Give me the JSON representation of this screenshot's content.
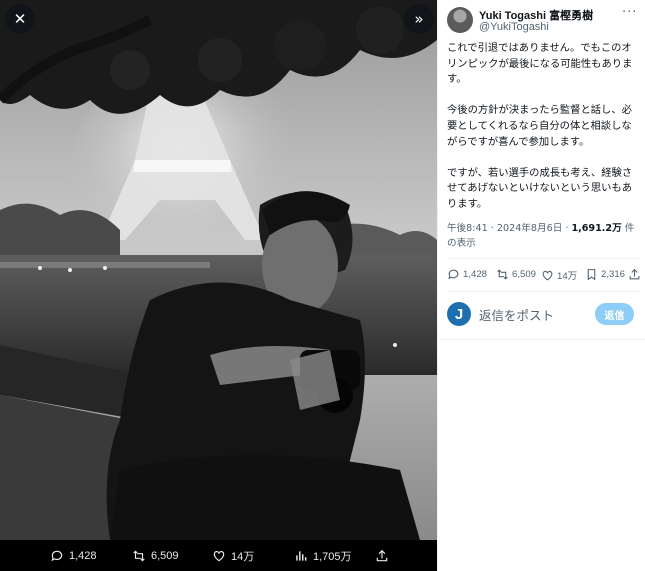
{
  "media": {
    "close_glyph": "✕",
    "expand_glyph": "»",
    "bar": {
      "replies": "1,428",
      "reposts": "6,509",
      "likes": "14万",
      "views": "1,705万"
    }
  },
  "post": {
    "author_name": "Yuki Togashi 富樫勇樹",
    "handle": "@YukiTogashi",
    "more_glyph": "···",
    "paragraphs": [
      "これで引退ではありません。でもこのオリンピックが最後になる可能性もあります。",
      "今後の方針が決まったら監督と話し、必要としてくれるなら自分の体と相談しながらですが喜んで参加します。",
      "ですが、若い選手の成長も考え、経験させてあげないといけないという思いもあります。"
    ],
    "timestamp": "午後8:41 · 2024年8月6日 · ",
    "view_count": "1,691.2万",
    "view_suffix": " 件の表示",
    "actions": {
      "replies": "1,428",
      "reposts": "6,509",
      "likes": "14万",
      "bookmarks": "2,316"
    }
  },
  "reply": {
    "avatar_letter": "J",
    "placeholder": "返信をポスト",
    "button_label": "返信"
  },
  "colors": {
    "accent": "#1d9bf0",
    "reply_button_disabled": "#8ecdf7",
    "muted_text": "#536471"
  },
  "icons": [
    "close-icon",
    "expand-icon",
    "reply-icon",
    "repost-icon",
    "like-icon",
    "views-icon",
    "share-icon",
    "bookmark-icon",
    "more-icon"
  ]
}
